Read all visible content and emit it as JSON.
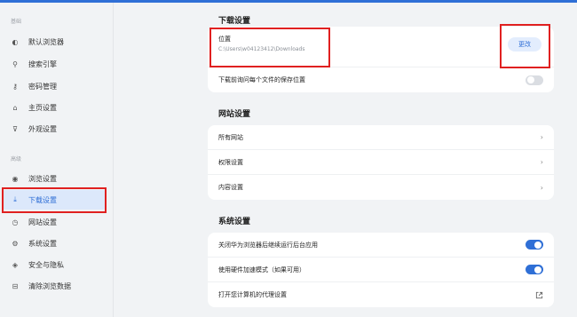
{
  "sidebar": {
    "basic_label": "基础",
    "advanced_label": "高级",
    "basic_items": [
      {
        "label": "默认浏览器",
        "icon": "browser-icon",
        "glyph": "◐"
      },
      {
        "label": "搜索引擎",
        "icon": "search-icon",
        "glyph": "⚲"
      },
      {
        "label": "密码管理",
        "icon": "key-icon",
        "glyph": "⚷"
      },
      {
        "label": "主页设置",
        "icon": "home-icon",
        "glyph": "⌂"
      },
      {
        "label": "外观设置",
        "icon": "appearance-icon",
        "glyph": "⊽"
      }
    ],
    "advanced_items": [
      {
        "label": "浏览设置",
        "icon": "eye-icon",
        "glyph": "◉"
      },
      {
        "label": "下载设置",
        "icon": "download-icon",
        "glyph": "⤓",
        "active": true
      },
      {
        "label": "网站设置",
        "icon": "site-icon",
        "glyph": "◷"
      },
      {
        "label": "系统设置",
        "icon": "system-icon",
        "glyph": "⚙"
      },
      {
        "label": "安全与隐私",
        "icon": "shield-icon",
        "glyph": "◈"
      },
      {
        "label": "清除浏览数据",
        "icon": "trash-icon",
        "glyph": "⊟"
      }
    ]
  },
  "download": {
    "title": "下载设置",
    "location_label": "位置",
    "location_path": "C:\\Users\\w04123412\\Downloads",
    "change_button": "更改",
    "ask_each_time": "下载前询问每个文件的保存位置",
    "ask_each_time_enabled": false
  },
  "website": {
    "title": "网站设置",
    "items": [
      "所有网站",
      "权限设置",
      "内容设置"
    ]
  },
  "system": {
    "title": "系统设置",
    "items": [
      {
        "label": "关闭华为浏览器后继续运行后台应用",
        "enabled": true
      },
      {
        "label": "使用硬件加速模式（如果可用）",
        "enabled": true
      }
    ],
    "proxy_label": "打开您计算机的代理设置"
  },
  "colors": {
    "accent": "#2f6fd6",
    "highlight": "#e02020"
  }
}
